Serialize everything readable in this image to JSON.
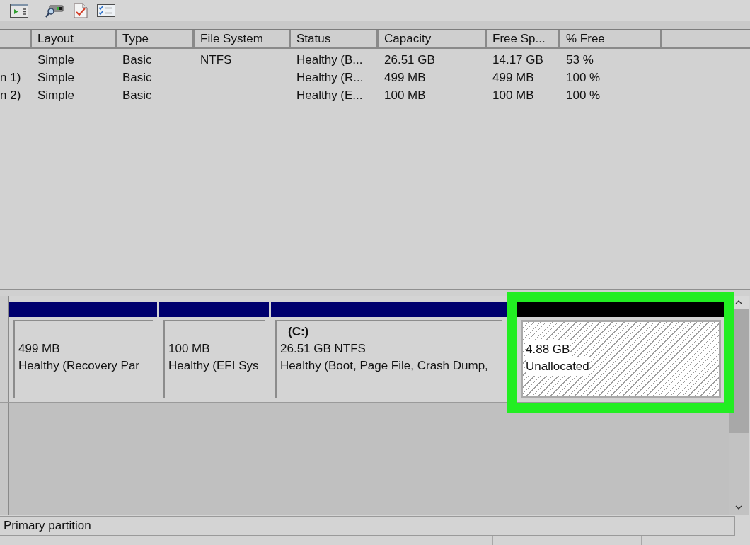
{
  "volume_list": {
    "columns": [
      "Layout",
      "Type",
      "File System",
      "Status",
      "Capacity",
      "Free Sp...",
      "% Free"
    ],
    "rows": [
      {
        "cells": [
          "Simple",
          "Basic",
          "NTFS",
          "Healthy (B...",
          "26.51 GB",
          "14.17 GB",
          "53 %"
        ]
      },
      {
        "column_1": "n 1)",
        "cells": [
          "Simple",
          "Basic",
          null,
          "Healthy (R...",
          "499 MB",
          "499 MB",
          "100 %"
        ]
      },
      {
        "column_1": "n 2)",
        "cells": [
          "Simple",
          "Basic",
          null,
          "Healthy (E...",
          "100 MB",
          "100 MB",
          "100 %"
        ]
      }
    ]
  },
  "disk_map": {
    "partitions": [
      {
        "kind": "primary",
        "size": "499 MB",
        "status": "Healthy (Recovery Par",
        "highlighted": false
      },
      {
        "kind": "primary",
        "size": "100 MB",
        "status": "Healthy (EFI Sys",
        "highlighted": false
      },
      {
        "kind": "primary",
        "label": "(C:)",
        "size": "26.51 GB NTFS",
        "status": "Healthy (Boot, Page File, Crash Dump,",
        "highlighted": false
      },
      {
        "kind": "unallocated",
        "size": "4.88 GB",
        "status": "Unallocated",
        "highlighted": true
      }
    ]
  },
  "status_bar": {
    "text": "Primary partition"
  }
}
